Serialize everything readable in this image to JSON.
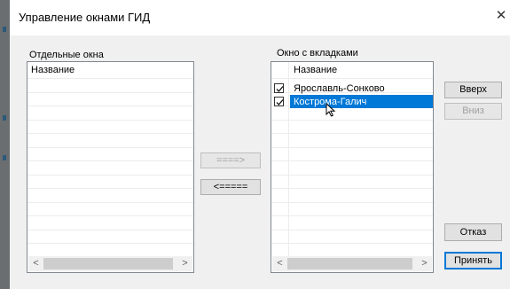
{
  "dialog": {
    "title": "Управление окнами ГИД",
    "close_glyph": "✕"
  },
  "left_panel": {
    "label": "Отдельные окна",
    "column_header": "Название",
    "items": []
  },
  "right_panel": {
    "label": "Окно с вкладками",
    "column_header": "Название",
    "items": [
      {
        "label": "Ярославль-Сонково",
        "checked": true,
        "selected": false
      },
      {
        "label": "Кострома-Галич",
        "checked": true,
        "selected": true
      }
    ]
  },
  "transfer": {
    "move_right_label": "====>",
    "move_left_label": "<=====",
    "move_right_enabled": false
  },
  "buttons": {
    "up_label": "Вверх",
    "down_label": "Вниз",
    "cancel_label": "Отказ",
    "accept_label": "Принять"
  },
  "scroll": {
    "left_arrow": "<",
    "right_arrow": ">"
  },
  "colors": {
    "selection": "#0078d7",
    "default_button_border": "#0078d7"
  },
  "icons": {
    "cursor": "mouse-pointer-icon",
    "checkbox": "checkmark-icon"
  }
}
